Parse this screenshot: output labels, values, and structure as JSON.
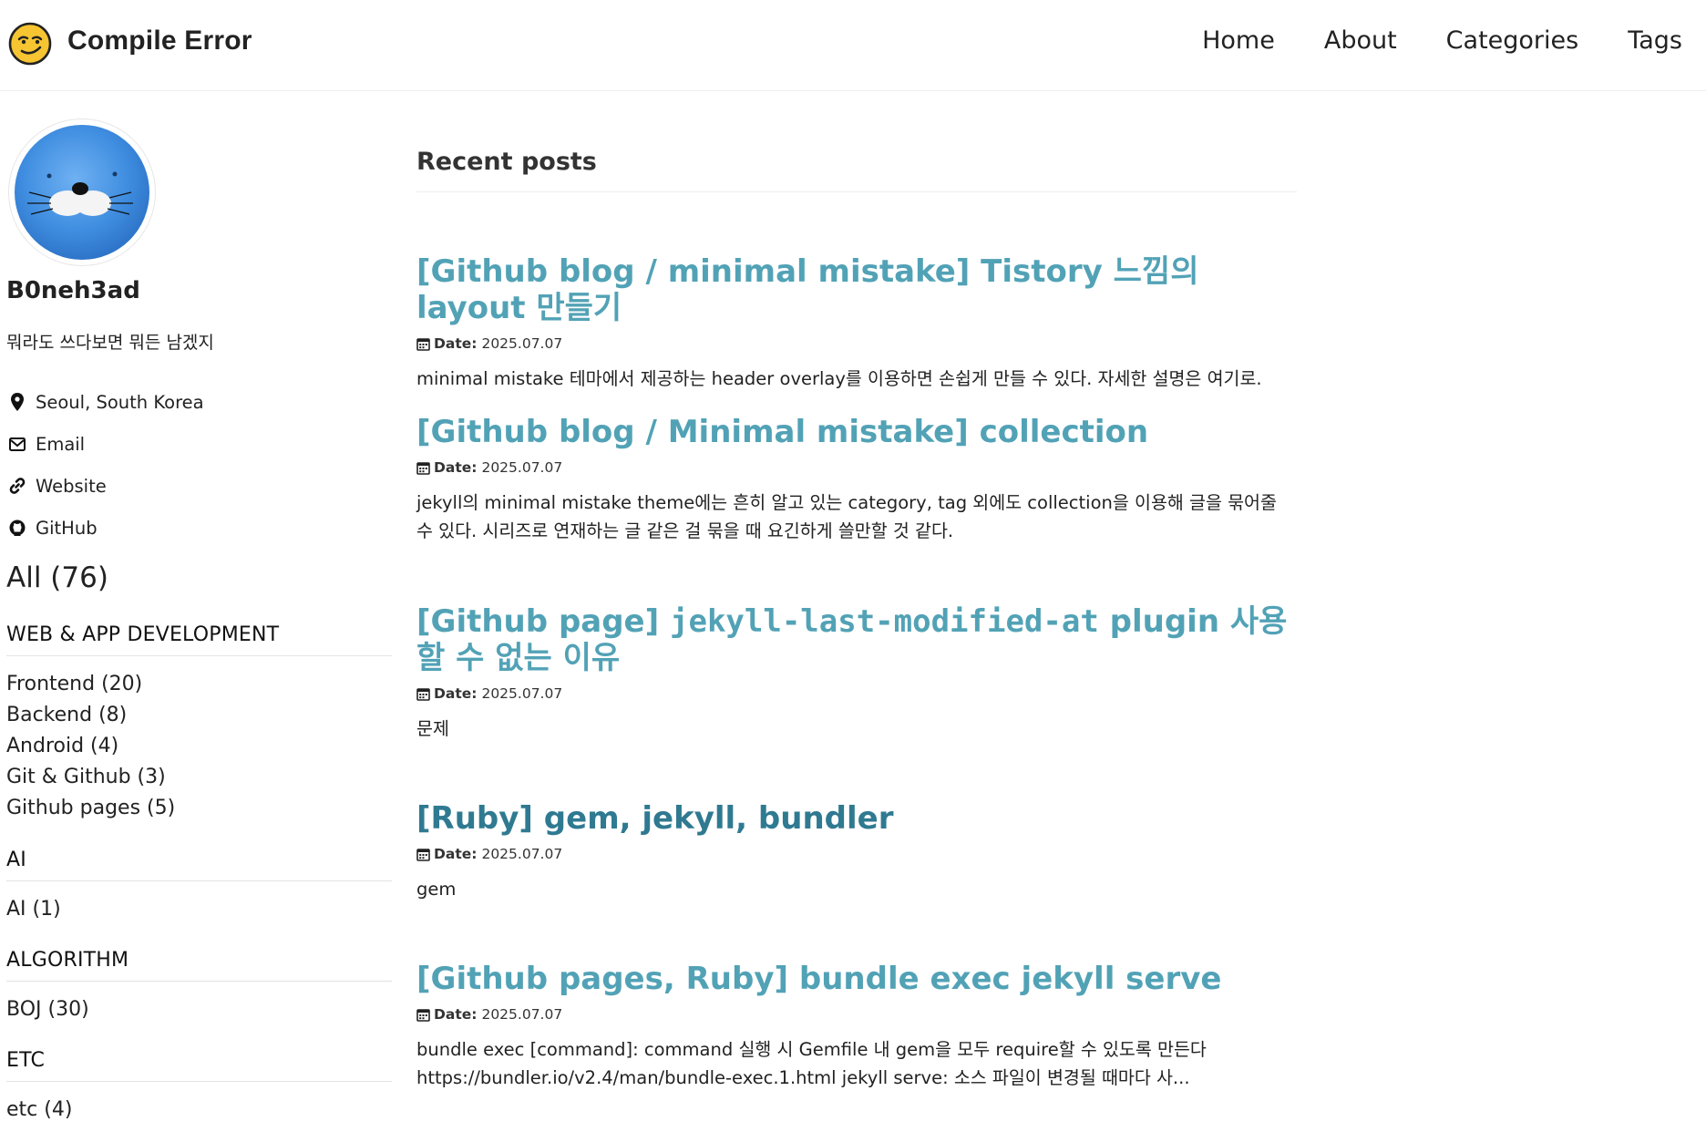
{
  "masthead": {
    "site_title": "Compile Error",
    "logo_icon": "smirk-emoji-icon",
    "nav": [
      "Home",
      "About",
      "Categories",
      "Tags"
    ]
  },
  "author": {
    "name": "B0neh3ad",
    "bio": "뭐라도 쓰다보면 뭐든 남겠지",
    "links": [
      {
        "icon": "map-marker-icon",
        "label": "Seoul, South Korea"
      },
      {
        "icon": "envelope-icon",
        "label": "Email"
      },
      {
        "icon": "link-icon",
        "label": "Website"
      },
      {
        "icon": "github-icon",
        "label": "GitHub"
      }
    ]
  },
  "categories": {
    "all": "All (76)",
    "groups": [
      {
        "heading": "WEB & APP DEVELOPMENT",
        "items": [
          "Frontend (20)",
          "Backend (8)",
          "Android (4)",
          "Git & Github (3)",
          "Github pages (5)"
        ]
      },
      {
        "heading": "AI",
        "items": [
          "AI (1)"
        ]
      },
      {
        "heading": "ALGORITHM",
        "items": [
          "BOJ (30)"
        ]
      },
      {
        "heading": "ETC",
        "items": [
          "etc (4)"
        ]
      }
    ]
  },
  "main": {
    "section_title": "Recent posts",
    "date_label": "Date:",
    "posts": [
      {
        "title": "[Github blog / minimal mistake] Tistory 느낌의 layout 만들기",
        "date": "2025.07.07",
        "excerpt": "minimal mistake 테마에서 제공하는 header overlay를 이용하면 손쉽게 만들 수 있다. 자세한 설명은 여기로."
      },
      {
        "title": "[Github blog / Minimal mistake] collection",
        "date": "2025.07.07",
        "excerpt": "jekyll의 minimal mistake theme에는 흔히 알고 있는 category, tag 외에도 collection을 이용해 글을 묶어줄 수 있다. 시리즈로 연재하는 글 같은 걸 묶을 때 요긴하게 쓸만할 것 같다."
      },
      {
        "title_prefix": "[Github page] ",
        "title_code": "jekyll-last-modified-at",
        "title_suffix": " plugin 사용할 수 없는 이유",
        "date": "2025.07.07",
        "excerpt": "문제"
      },
      {
        "title": "[Ruby] gem, jekyll, bundler",
        "date": "2025.07.07",
        "excerpt": "gem"
      },
      {
        "title": "[Github pages, Ruby] bundle exec jekyll serve",
        "date": "2025.07.07",
        "excerpt": "bundle exec [command]: command 실행 시 Gemfile 내 gem을 모두 require할 수 있도록 만든다 https://bundler.io/v2.4/man/bundle-exec.1.html jekyll serve: 소스 파일이 변경될 때마다 사..."
      }
    ]
  },
  "colors": {
    "link": "#52a2b6",
    "link_visited": "#2f7a91",
    "text": "#222222",
    "rule": "#eeeeee"
  }
}
